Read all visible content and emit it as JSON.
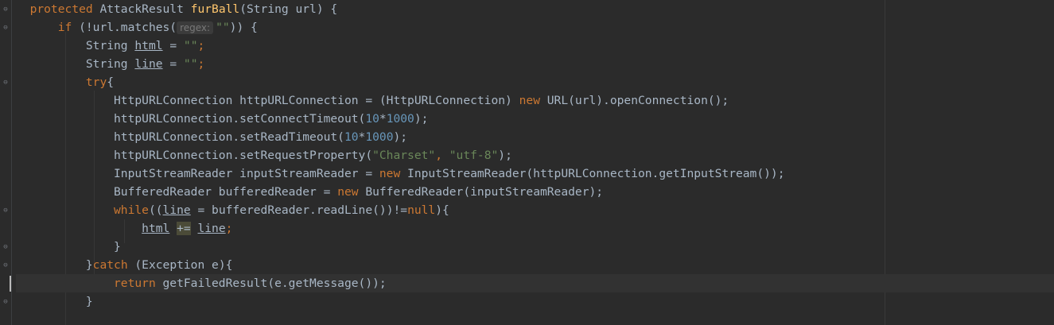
{
  "editor": {
    "lines": [
      {
        "indent": "  ",
        "kw1": "protected",
        "t1": " AttackResult ",
        "fn": "furBall",
        "t2": "(String url) {"
      },
      {
        "indent": "      ",
        "kw1": "if",
        "t1": " (!url.matches(",
        "hint": "regex:",
        "str": "\"\"",
        "t2": ")) {"
      },
      {
        "indent": "          ",
        "t1": "String ",
        "v": "html",
        "t2": " = ",
        "str": "\"\"",
        "t3": ";"
      },
      {
        "indent": "          ",
        "t1": "String ",
        "v": "line",
        "t2": " = ",
        "str": "\"\"",
        "t3": ";"
      },
      {
        "indent": "          ",
        "kw1": "try",
        "t1": "{"
      },
      {
        "indent": "              ",
        "t1": "HttpURLConnection httpURLConnection = (HttpURLConnection) ",
        "kw1": "new",
        "t2": " URL(url).openConnection();"
      },
      {
        "indent": "              ",
        "t1": "httpURLConnection.setConnectTimeout(",
        "n1": "10",
        "t2": "*",
        "n2": "1000",
        "t3": ");"
      },
      {
        "indent": "              ",
        "t1": "httpURLConnection.setReadTimeout(",
        "n1": "10",
        "t2": "*",
        "n2": "1000",
        "t3": ");"
      },
      {
        "indent": "              ",
        "t1": "httpURLConnection.setRequestProperty(",
        "s1": "\"Charset\"",
        "t2": ", ",
        "s2": "\"utf-8\"",
        "t3": ");"
      },
      {
        "indent": "              ",
        "t1": "InputStreamReader inputStreamReader = ",
        "kw1": "new",
        "t2": " InputStreamReader(httpURLConnection.getInputStream());"
      },
      {
        "indent": "              ",
        "t1": "BufferedReader bufferedReader = ",
        "kw1": "new",
        "t2": " BufferedReader(inputStreamReader);"
      },
      {
        "indent": "              ",
        "kw1": "while",
        "t1": "((",
        "v": "line",
        "t2": " = bufferedReader.readLine())!=",
        "kw2": "null",
        "t3": "){"
      },
      {
        "indent": "                  ",
        "v": "html",
        "t1": " ",
        "op": "+=",
        "t2": " ",
        "v2": "line",
        "t3": ";"
      },
      {
        "indent": "              ",
        "t1": "}"
      },
      {
        "indent": "          ",
        "t1": "}",
        "kw1": "catch",
        "t2": " (Exception e){"
      },
      {
        "indent": "              ",
        "kw1": "return",
        "t1": " getFailedResult(e.getMessage());"
      },
      {
        "indent": "          ",
        "t1": "}"
      }
    ]
  }
}
